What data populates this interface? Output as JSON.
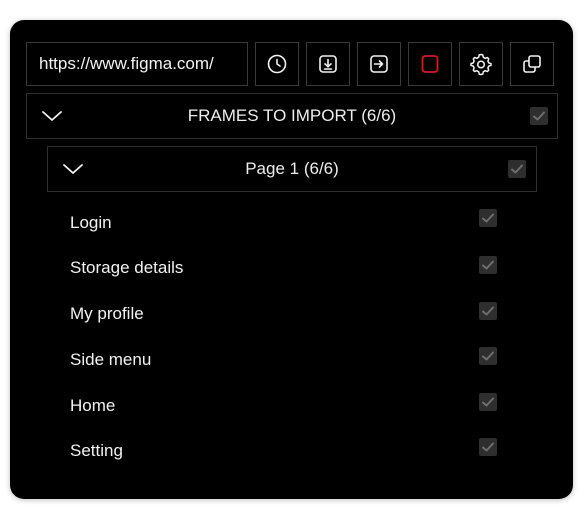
{
  "toolbar": {
    "url_value": "https://www.figma.com/",
    "buttons": [
      {
        "icon": "clock-icon"
      },
      {
        "icon": "download-icon"
      },
      {
        "icon": "import-arrow-icon"
      },
      {
        "icon": "stop-square-icon",
        "color": "#e0161b"
      },
      {
        "icon": "gear-icon"
      },
      {
        "icon": "duplicate-icon"
      }
    ]
  },
  "section": {
    "label": "FRAMES TO IMPORT (6/6)",
    "checked": true
  },
  "page": {
    "label": "Page 1 (6/6)",
    "checked": true
  },
  "frames": [
    {
      "label": "Login",
      "checked": true
    },
    {
      "label": "Storage details",
      "checked": true
    },
    {
      "label": "My profile",
      "checked": true
    },
    {
      "label": "Side menu",
      "checked": true
    },
    {
      "label": "Home",
      "checked": true
    },
    {
      "label": "Setting",
      "checked": true
    }
  ],
  "colors": {
    "background": "#000000",
    "text": "#f2f2f2",
    "checkbox_fill": "#2e2e2e",
    "checkmark": "#6e6e6e",
    "stop_accent": "#e0161b"
  }
}
